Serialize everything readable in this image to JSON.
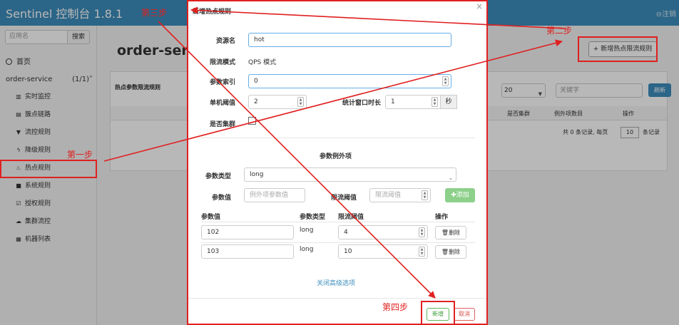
{
  "navbar": {
    "brand": "Sentinel 控制台 1.8.1",
    "logout": "⊖注销"
  },
  "sidebar": {
    "search_placeholder": "应用名",
    "search_button": "搜索",
    "home": "首页",
    "app": {
      "name": "order-service",
      "count": "(1/1)˅"
    },
    "items": [
      {
        "label": "实时监控",
        "icon": "chart-icon"
      },
      {
        "label": "簇点链路",
        "icon": "list-icon"
      },
      {
        "label": "流控规则",
        "icon": "filter-icon"
      },
      {
        "label": "降级规则",
        "icon": "bolt-icon"
      },
      {
        "label": "热点规则",
        "icon": "fire-icon"
      },
      {
        "label": "系统规则",
        "icon": "lock-icon"
      },
      {
        "label": "授权规则",
        "icon": "check-icon"
      },
      {
        "label": "集群流控",
        "icon": "cloud-icon"
      },
      {
        "label": "机器列表",
        "icon": "grid-icon"
      }
    ]
  },
  "main": {
    "title": "order-servic",
    "add_button": "+ 新增热点限流规则",
    "panel_title": "热点参数限流规则",
    "page_size": "20",
    "keyword_placeholder": "关键字",
    "refresh": "刷新",
    "columns": [
      "是否集群",
      "例外项数目",
      "操作"
    ],
    "pager": {
      "prefix": "共 0 条记录, 每页",
      "size": "10",
      "suffix": "条记录"
    }
  },
  "modal": {
    "title": "新增热点规则",
    "close": "×",
    "resource_label": "资源名",
    "resource_value": "hot",
    "mode_label": "限流模式",
    "mode_value": "QPS 模式",
    "index_label": "参数索引",
    "index_value": "0",
    "threshold_label": "单机阈值",
    "threshold_value": "2",
    "window_label": "统计窗口时长",
    "window_value": "1",
    "window_unit": "秒",
    "cluster_label": "是否集群",
    "exception_title": "参数例外项",
    "param_type_label": "参数类型",
    "param_type_value": "long",
    "param_value_label": "参数值",
    "param_value_placeholder": "例外项参数值",
    "limit_label": "限流阈值",
    "limit_placeholder": "限流阈值",
    "add_button": "添加",
    "table_headers": [
      "参数值",
      "参数类型",
      "限流阈值",
      "操作"
    ],
    "rows": [
      {
        "value": "102",
        "type": "long",
        "limit": "4",
        "action": "删除"
      },
      {
        "value": "103",
        "type": "long",
        "limit": "10",
        "action": "删除"
      }
    ],
    "close_advanced": "关闭高级选项",
    "new_button": "新增",
    "cancel_button": "取消"
  },
  "annotations": {
    "step1": "第一步",
    "step2": "第二步",
    "step3": "第三步",
    "step4": "第四步"
  },
  "colors": {
    "navbar": "#3c8dbc",
    "annotation": "#e02020",
    "add_button": "#8dd08a"
  }
}
